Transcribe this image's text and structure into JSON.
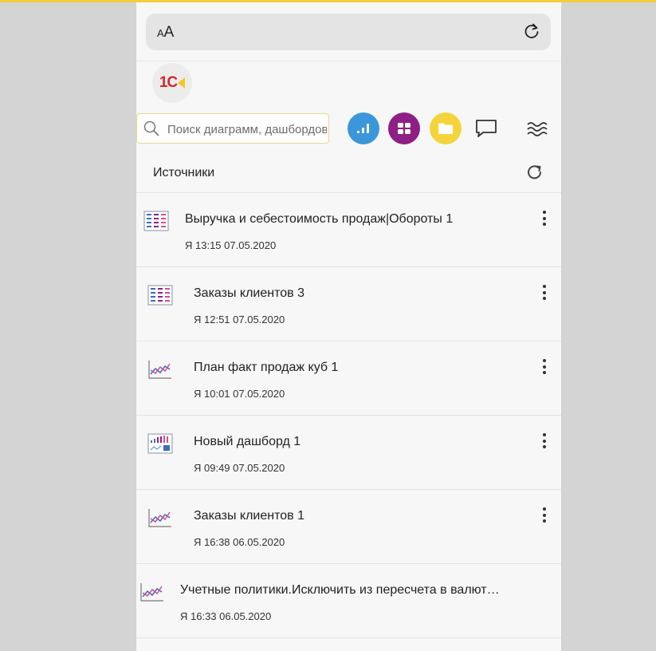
{
  "browser": {
    "aa_small": "A",
    "aa_large": "A"
  },
  "app": {
    "logo_text": "1C"
  },
  "search": {
    "placeholder": "Поиск диаграмм, дашбордов"
  },
  "toolbar": {
    "icons": [
      "chart-icon",
      "dashboard-icon",
      "folder-icon",
      "message-icon",
      "menu-icon"
    ],
    "colors": {
      "chart": "#3b97d9",
      "dashboard": "#8e1f86",
      "folder": "#f4d43b"
    }
  },
  "section": {
    "title": "Источники"
  },
  "items": [
    {
      "title": "Выручка и себестоимость продаж|Обороты 1",
      "meta": "Я 13:15 07.05.2020",
      "icon": "table-icon"
    },
    {
      "title": "Заказы клиентов 3",
      "meta": "Я 12:51 07.05.2020",
      "icon": "table-icon"
    },
    {
      "title": "План факт продаж куб 1",
      "meta": "Я 10:01 07.05.2020",
      "icon": "line-chart-icon"
    },
    {
      "title": "Новый дашборд 1",
      "meta": "Я 09:49 07.05.2020",
      "icon": "dashboard-thumb-icon"
    },
    {
      "title": "Заказы клиентов 1",
      "meta": "Я 16:38 06.05.2020",
      "icon": "line-chart-icon"
    },
    {
      "title": "Учетные политики.Исключить из пересчета в валют…",
      "meta": "Я 16:33 06.05.2020",
      "icon": "line-chart-icon"
    }
  ]
}
